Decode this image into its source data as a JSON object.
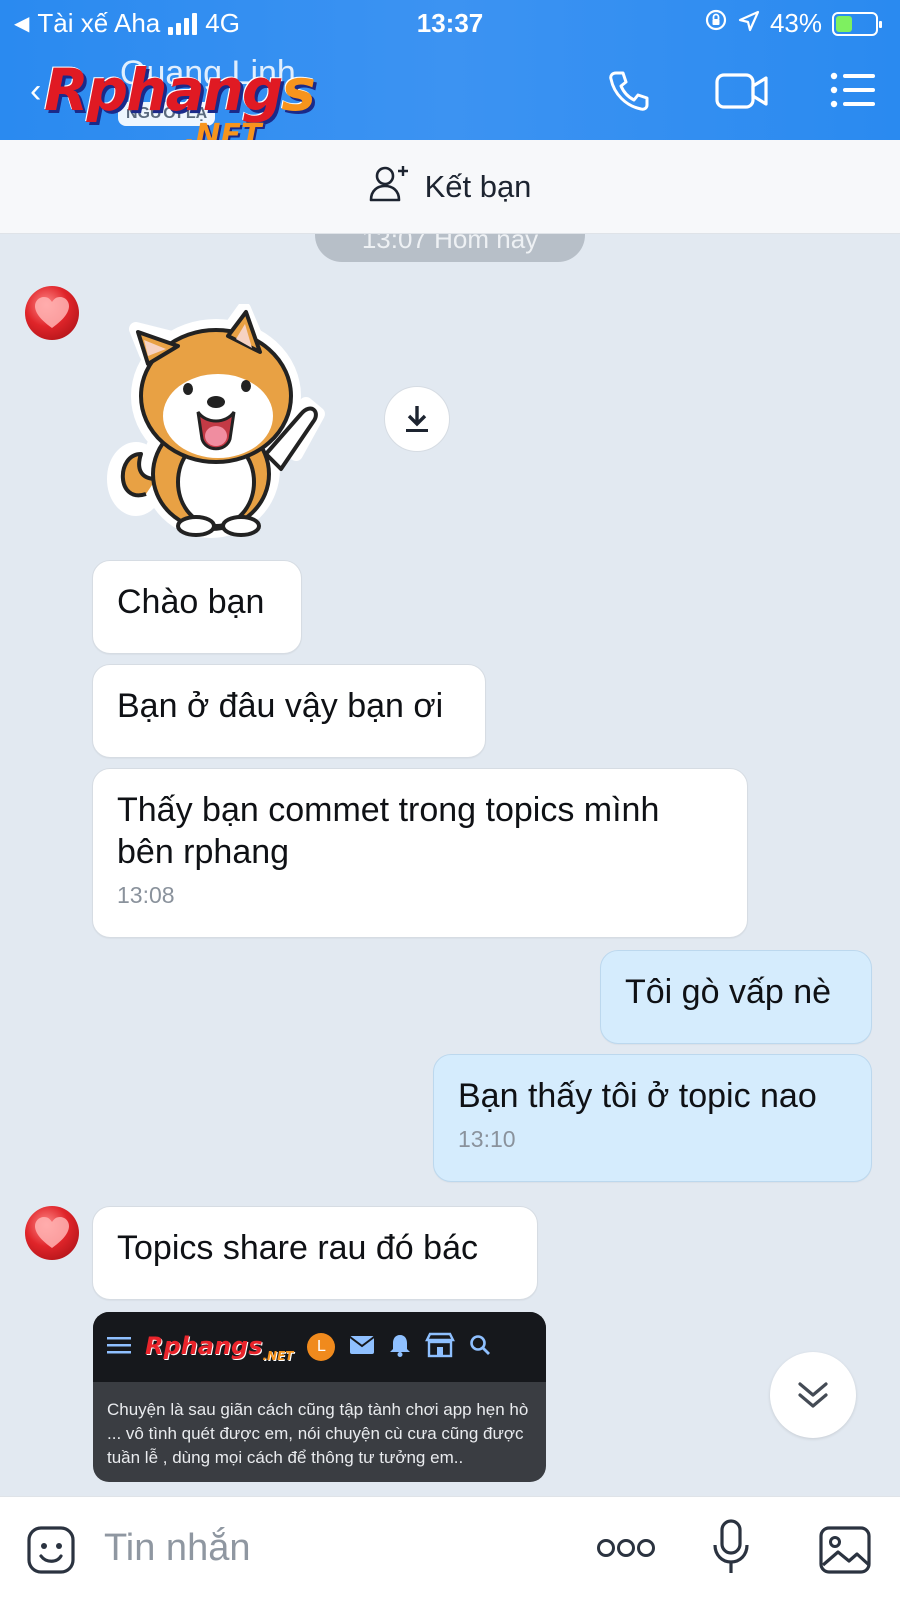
{
  "status_bar": {
    "carrier": "Tài xế Aha",
    "network": "4G",
    "time": "13:37",
    "battery": "43%",
    "battery_level": 0.43
  },
  "header": {
    "contact_name": "Quang Linh",
    "contact_subtitle": "NGƯỜI LẠ",
    "watermark_logo": "Rphangs.NET",
    "call_icon": "phone-icon",
    "video_icon": "video-camera-icon",
    "menu_icon": "list-menu-icon"
  },
  "add_friend": {
    "label": "Kết bạn",
    "icon": "add-user-icon"
  },
  "chat": {
    "date_separator": "13:07 Hôm nay",
    "messages": [
      {
        "type": "sticker",
        "sender": "other",
        "description_icon": "shiba-dog-sticker"
      },
      {
        "type": "text",
        "sender": "other",
        "text": "Chào bạn"
      },
      {
        "type": "text",
        "sender": "other",
        "text": "Bạn ở đâu vậy bạn ơi"
      },
      {
        "type": "text",
        "sender": "other",
        "text": "Thấy bạn commet trong topics mình bên rphang",
        "time": "13:08"
      },
      {
        "type": "text",
        "sender": "me",
        "text": "Tôi gò vấp nè"
      },
      {
        "type": "text",
        "sender": "me",
        "text": "Bạn thấy tôi ở topic nao",
        "time": "13:10"
      },
      {
        "type": "text",
        "sender": "other",
        "text": "Topics share rau đó bác"
      },
      {
        "type": "image",
        "sender": "other",
        "screenshot": {
          "logo": "Rphangs",
          "logo_sub": ".NET",
          "avatar_letter": "L",
          "text": "Chuyện là sau giãn cách cũng tập tành chơi app hẹn hò ... vô tình quét được em, nói chuyện cù cưa cũng được tuần lễ , dùng mọi cách để thông tư tưởng em.."
        }
      }
    ]
  },
  "input_bar": {
    "placeholder": "Tin nhắn",
    "icons": [
      "sticker-icon",
      "more-options-icon",
      "microphone-icon",
      "image-icon"
    ]
  },
  "colors": {
    "header_blue": "#3c93f2",
    "chat_background": "#e2e9f1",
    "my_bubble": "#d5ecfd",
    "other_bubble": "#ffffff"
  }
}
